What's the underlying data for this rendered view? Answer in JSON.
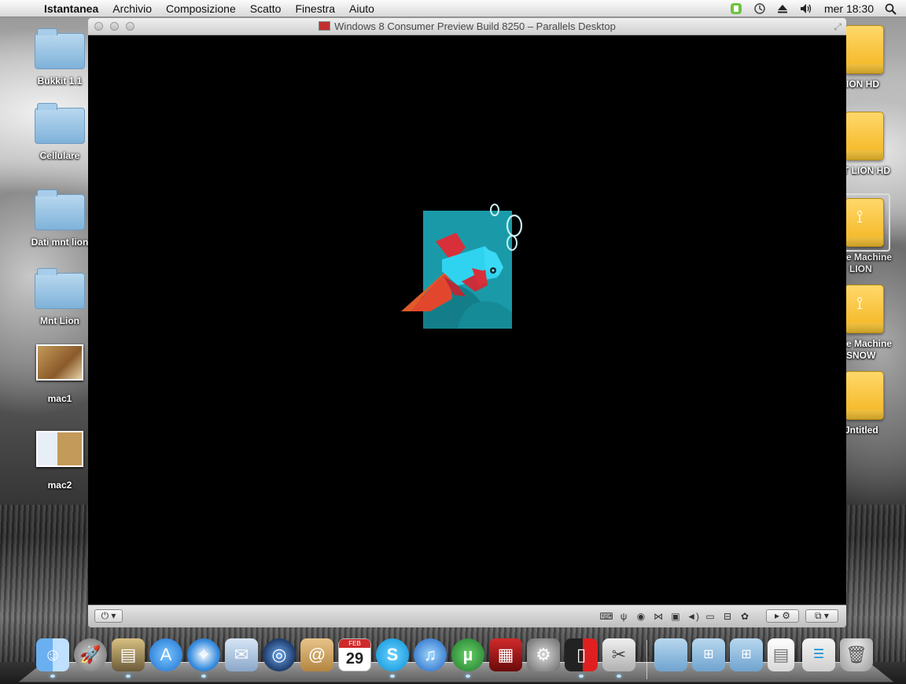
{
  "menubar": {
    "apple_icon": "apple-icon",
    "app_name": "Istantanea",
    "menus": [
      "Archivio",
      "Composizione",
      "Scatto",
      "Finestra",
      "Aiuto"
    ],
    "clock": "mer 18:30",
    "status_icons": [
      "evernote-icon",
      "time-machine-icon",
      "eject-icon",
      "volume-icon",
      "spotlight-icon"
    ]
  },
  "desktop_left": [
    {
      "label": "Bukkit 1.1",
      "kind": "folder"
    },
    {
      "label": "Cellulare",
      "kind": "folder"
    },
    {
      "label": "Dati mnt lion",
      "kind": "folder"
    },
    {
      "label": "Mnt Lion",
      "kind": "folder"
    },
    {
      "label": "mac1",
      "kind": "image"
    },
    {
      "label": "mac2",
      "kind": "image"
    }
  ],
  "desktop_right": [
    {
      "label": "ION HD",
      "kind": "drive"
    },
    {
      "label": "T LION HD",
      "kind": "drive"
    },
    {
      "label": "e Machine",
      "label2": "LION",
      "kind": "usb-drive"
    },
    {
      "label": "e Machine",
      "label2": "SNOW",
      "kind": "usb-drive"
    },
    {
      "label": "Jntitled",
      "kind": "drive"
    }
  ],
  "vm_window": {
    "title": "Windows 8 Consumer Preview Build 8250 – Parallels Desktop",
    "colors": {
      "tile": "#1a9aa8",
      "fish_body": "#2fd3f0",
      "fin_red": "#d8303a",
      "fin_orange": "#e05a2a"
    }
  },
  "statusbar": {
    "power_icon": "power-icon",
    "device_icons": [
      "keyboard-icon",
      "usb-icon",
      "cd-icon",
      "network-icon",
      "floppy-icon",
      "sound-icon",
      "hdd-icon",
      "shared-folder-icon",
      "printer-icon"
    ],
    "config_icon": "gear-icon",
    "view_icon": "view-mode-icon"
  },
  "dock": {
    "apps": [
      "Finder",
      "Launchpad",
      "Image Capture",
      "App Store",
      "Safari",
      "Mail",
      "FaceTime",
      "Address Book",
      "iCal",
      "Skype",
      "iTunes",
      "uTorrent",
      "Photo Booth",
      "System Preferences",
      "Parallels",
      "Screenshot"
    ],
    "ical_month": "FEB",
    "ical_day": "29",
    "right_items": [
      "Folder",
      "Windows Folder",
      "Windows Folder 2",
      "Document",
      "Skype Window",
      "Trash"
    ]
  }
}
